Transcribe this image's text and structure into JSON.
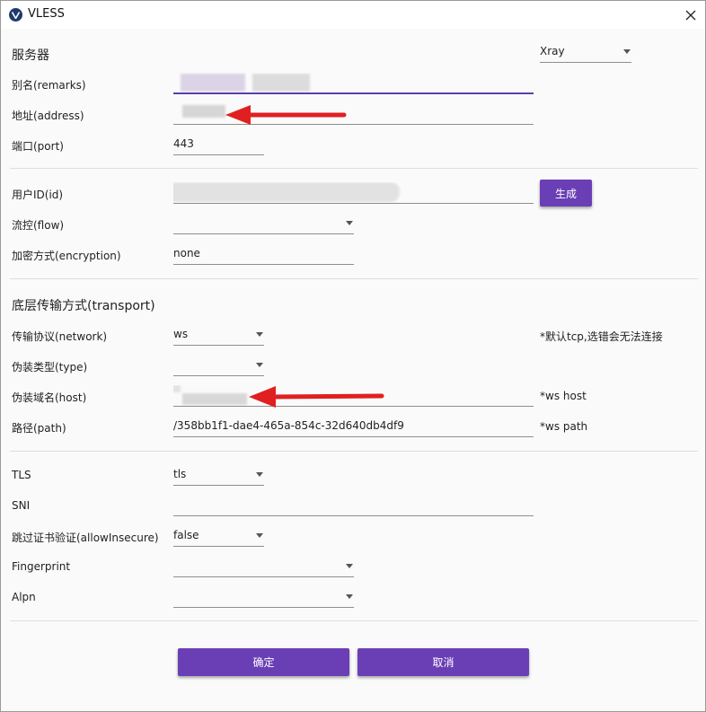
{
  "window": {
    "title": "VLESS",
    "icon": "v2ray-logo-icon",
    "close_icon": "close-icon"
  },
  "server": {
    "title": "服务器",
    "core_select": "Xray",
    "remarks_label": "别名(remarks)",
    "address_label": "地址(address)",
    "port_label": "端口(port)",
    "port_value": "443"
  },
  "user": {
    "id_label": "用户ID(id)",
    "generate_button": "生成",
    "flow_label": "流控(flow)",
    "flow_value": "",
    "encryption_label": "加密方式(encryption)",
    "encryption_value": "none"
  },
  "transport": {
    "title": "底层传输方式(transport)",
    "network_label": "传输协议(network)",
    "network_value": "ws",
    "network_hint": "*默认tcp,选错会无法连接",
    "type_label": "伪装类型(type)",
    "type_value": "",
    "host_label": "伪装域名(host)",
    "host_hint": "*ws host",
    "path_label": "路径(path)",
    "path_value": "/358bb1f1-dae4-465a-854c-32d640db4df9",
    "path_hint": "*ws path"
  },
  "tls": {
    "tls_label": "TLS",
    "tls_value": "tls",
    "sni_label": "SNI",
    "sni_value": "",
    "insecure_label": "跳过证书验证(allowInsecure)",
    "insecure_value": "false",
    "fingerprint_label": "Fingerprint",
    "fingerprint_value": "",
    "alpn_label": "Alpn",
    "alpn_value": ""
  },
  "footer": {
    "ok_button": "确定",
    "cancel_button": "取消"
  },
  "colors": {
    "accent": "#6a3fb5",
    "annotation_arrow": "#e02020"
  }
}
